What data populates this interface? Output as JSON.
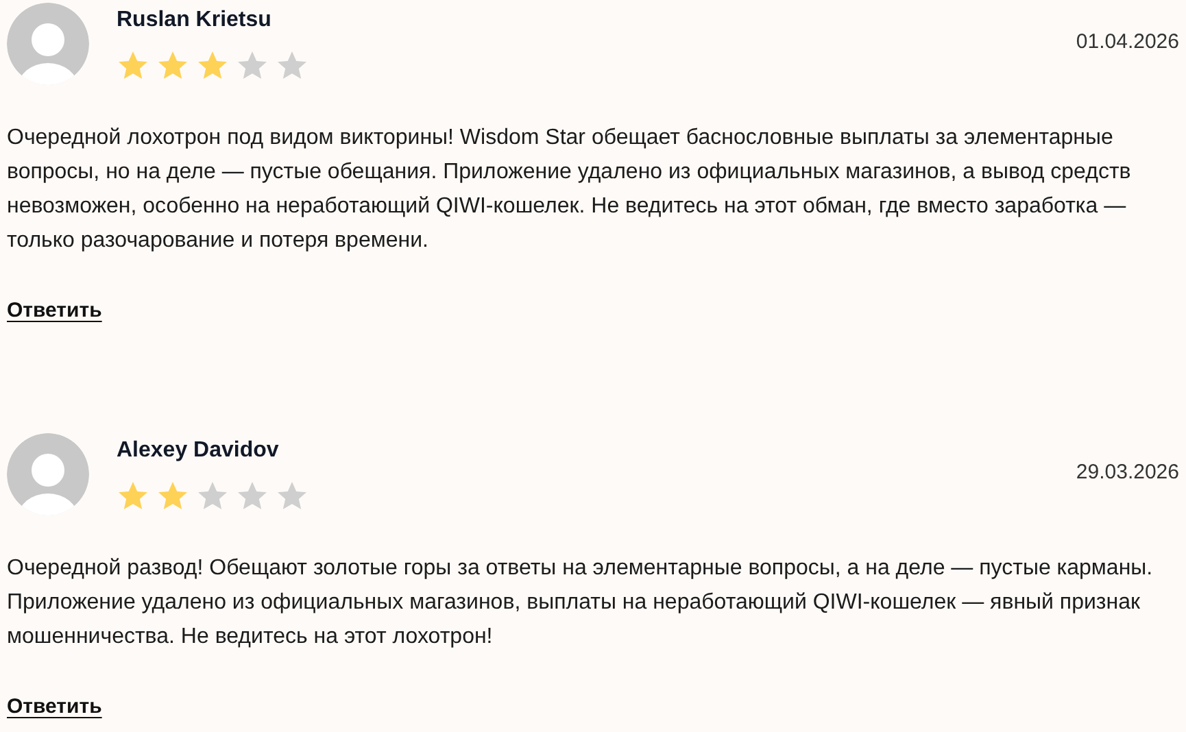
{
  "reviews": [
    {
      "author": "Ruslan Krietsu",
      "stars": 3,
      "date": "01.04.2026",
      "text": "Очередной лохотрон под видом викторины! Wisdom Star обещает баснословные выплаты за элементарные вопросы, но на деле — пустые обещания. Приложение удалено из официальных магазинов, а вывод средств невозможен, особенно на неработающий QIWI-кошелек. Не ведитесь на этот обман, где вместо заработка — только разочарование и потеря времени.",
      "reply": "Ответить"
    },
    {
      "author": "Alexey Davidov",
      "stars": 2,
      "date": "29.03.2026",
      "text": "Очередной развод! Обещают золотые горы за ответы на элементарные вопросы, а на деле — пустые карманы. Приложение удалено из официальных магазинов, выплаты на неработающий QIWI-кошелек — явный признак мошенничества. Не ведитесь на этот лохотрон!",
      "reply": "Ответить"
    }
  ]
}
